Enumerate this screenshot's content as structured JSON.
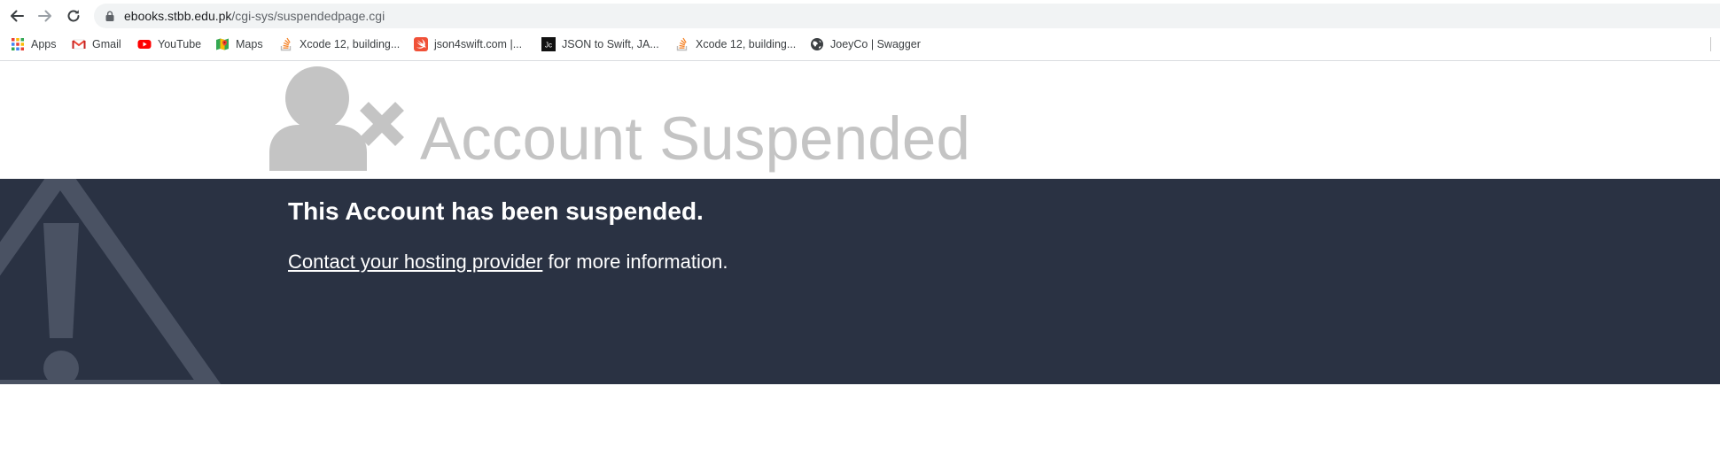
{
  "browser": {
    "url_host": "ebooks.stbb.edu.pk",
    "url_path": "/cgi-sys/suspendedpage.cgi",
    "bookmarks": [
      {
        "label": "Apps",
        "icon": "apps-grid-icon"
      },
      {
        "label": "Gmail",
        "icon": "gmail-icon"
      },
      {
        "label": "YouTube",
        "icon": "youtube-icon"
      },
      {
        "label": "Maps",
        "icon": "maps-icon"
      },
      {
        "label": "Xcode 12, building...",
        "icon": "stackoverflow-icon"
      },
      {
        "label": "json4swift.com |...",
        "icon": "json4swift-icon"
      },
      {
        "label": "JSON to Swift, JA...",
        "icon": "jc-icon"
      },
      {
        "label": "Xcode 12, building...",
        "icon": "stackoverflow-icon"
      },
      {
        "label": "JoeyCo | Swagger",
        "icon": "globe-icon"
      }
    ]
  },
  "page": {
    "headline": "Account Suspended",
    "banner_title": "This Account has been suspended.",
    "contact_link": "Contact your hosting provider",
    "contact_suffix": " for more information."
  },
  "colors": {
    "banner_bg": "#2a3243",
    "headline_gray": "#c4c4c4",
    "warning_icon": "#4a5263"
  }
}
